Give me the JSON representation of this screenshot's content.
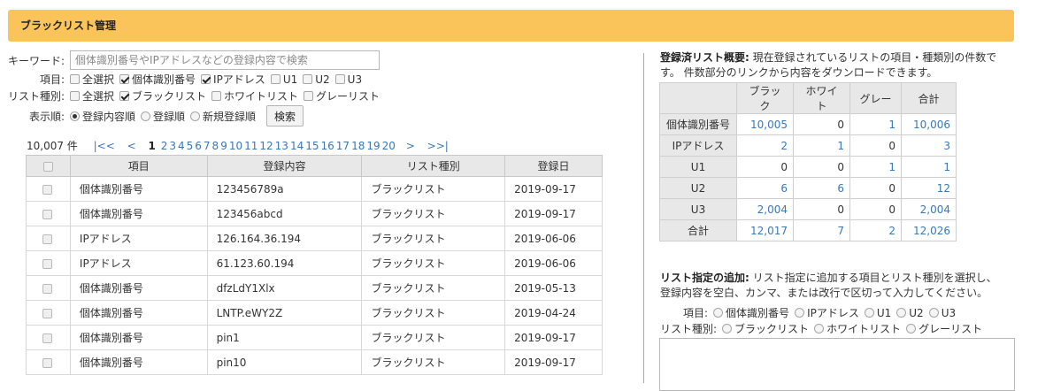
{
  "header": {
    "title": "ブラックリスト管理"
  },
  "search": {
    "keyword_label": "キーワード:",
    "keyword_placeholder": "個体識別番号やIPアドレスなどの登録内容で検索",
    "items_label": "項目:",
    "items": [
      {
        "label": "全選択",
        "checked": false
      },
      {
        "label": "個体識別番号",
        "checked": true
      },
      {
        "label": "IPアドレス",
        "checked": true
      },
      {
        "label": "U1",
        "checked": false
      },
      {
        "label": "U2",
        "checked": false
      },
      {
        "label": "U3",
        "checked": false
      }
    ],
    "types_label": "リスト種別:",
    "types": [
      {
        "label": "全選択",
        "checked": false
      },
      {
        "label": "ブラックリスト",
        "checked": true
      },
      {
        "label": "ホワイトリスト",
        "checked": false
      },
      {
        "label": "グレーリスト",
        "checked": false
      }
    ],
    "order_label": "表示順:",
    "orders": [
      {
        "label": "登録内容順",
        "checked": true
      },
      {
        "label": "登録順",
        "checked": false
      },
      {
        "label": "新規登録順",
        "checked": false
      }
    ],
    "search_button": "検索"
  },
  "pager": {
    "count": "10,007 件",
    "first": "|<<",
    "prev": "<",
    "current": "1",
    "pages": [
      "2",
      "3",
      "4",
      "5",
      "6",
      "7",
      "8",
      "9",
      "10",
      "11",
      "12",
      "13",
      "14",
      "15",
      "16",
      "17",
      "18",
      "19",
      "20"
    ],
    "next": ">",
    "last": ">>|"
  },
  "table": {
    "headers": [
      "項目",
      "登録内容",
      "リスト種別",
      "登録日"
    ],
    "rows": [
      {
        "item": "個体識別番号",
        "content": "123456789a",
        "type": "ブラックリスト",
        "date": "2019-09-17"
      },
      {
        "item": "個体識別番号",
        "content": "123456abcd",
        "type": "ブラックリスト",
        "date": "2019-09-17"
      },
      {
        "item": "IPアドレス",
        "content": "126.164.36.194",
        "type": "ブラックリスト",
        "date": "2019-06-06"
      },
      {
        "item": "IPアドレス",
        "content": "61.123.60.194",
        "type": "ブラックリスト",
        "date": "2019-06-06"
      },
      {
        "item": "個体識別番号",
        "content": "dfzLdY1Xlx",
        "type": "ブラックリスト",
        "date": "2019-05-13"
      },
      {
        "item": "個体識別番号",
        "content": "LNTP.eWY2Z",
        "type": "ブラックリスト",
        "date": "2019-04-24"
      },
      {
        "item": "個体識別番号",
        "content": "pin1",
        "type": "ブラックリスト",
        "date": "2019-09-17"
      },
      {
        "item": "個体識別番号",
        "content": "pin10",
        "type": "ブラックリスト",
        "date": "2019-09-17"
      }
    ]
  },
  "summary": {
    "title": "登録済リスト概要:",
    "desc1": "現在登録されているリストの項目・種類別の件数で",
    "desc2": "す。 件数部分のリンクから内容をダウンロードできます。",
    "headers": [
      "ブラック",
      "ホワイト",
      "グレー",
      "合計"
    ],
    "rows": [
      {
        "label": "個体識別番号",
        "values": [
          "10,005",
          "0",
          "1",
          "10,006"
        ]
      },
      {
        "label": "IPアドレス",
        "values": [
          "2",
          "1",
          "0",
          "3"
        ]
      },
      {
        "label": "U1",
        "values": [
          "0",
          "0",
          "1",
          "1"
        ]
      },
      {
        "label": "U2",
        "values": [
          "6",
          "6",
          "0",
          "12"
        ]
      },
      {
        "label": "U3",
        "values": [
          "2,004",
          "0",
          "0",
          "2,004"
        ]
      },
      {
        "label": "合計",
        "values": [
          "12,017",
          "7",
          "2",
          "12,026"
        ]
      }
    ]
  },
  "add": {
    "title": "リスト指定の追加:",
    "desc1": "リスト指定に追加する項目とリスト種別を選択し、",
    "desc2": "登録内容を空白、カンマ、または改行で区切って入力してください。",
    "items_label": "項目:",
    "items": [
      "個体識別番号",
      "IPアドレス",
      "U1",
      "U2",
      "U3"
    ],
    "types_label": "リスト種別:",
    "types": [
      "ブラックリスト",
      "ホワイトリスト",
      "グレーリスト"
    ]
  },
  "colors": {
    "header_bg": "#fbc45a",
    "link": "#3a78b6"
  }
}
